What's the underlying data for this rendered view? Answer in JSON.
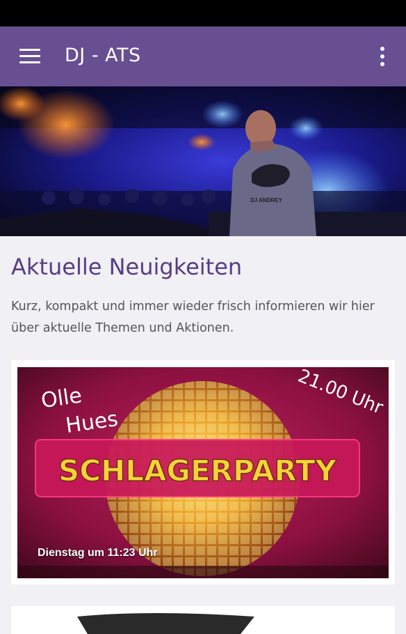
{
  "app": {
    "title": "DJ - ATS",
    "accent": "#674f92"
  },
  "icons": {
    "menu": "hamburger-icon",
    "more": "more-vertical-icon"
  },
  "hero": {
    "shirt_text": "DJ ANDREY"
  },
  "news": {
    "title": "Aktuelle Neuigkeiten",
    "description": "Kurz, kompakt und immer wieder frisch informieren wir hier über aktuelle Themen und Aktionen."
  },
  "cards": [
    {
      "poster": {
        "venue": [
          "Olle",
          "Hues"
        ],
        "time": "21.00 Uhr",
        "headline": "SCHLAGERPARTY"
      },
      "timestamp": "Dienstag um 11:23 Uhr"
    }
  ]
}
